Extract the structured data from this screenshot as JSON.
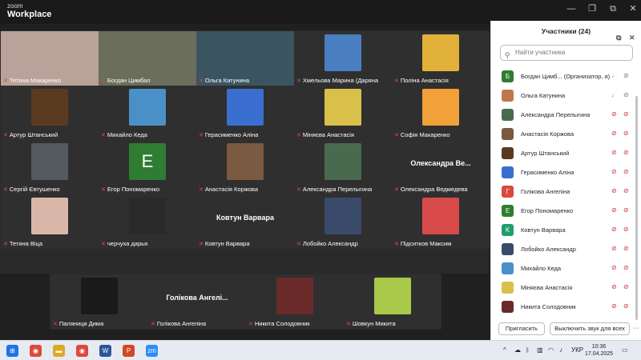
{
  "app": {
    "brand_small": "zoom",
    "brand": "Workplace"
  },
  "window_controls": {
    "minimize": "—",
    "maximize": "❐",
    "restore": "⧉",
    "close": "✕"
  },
  "grid_tiles": [
    {
      "name": "Тетяна Макаренко",
      "kind": "video",
      "color": "#b9a29a"
    },
    {
      "name": "Богдан Цимбал",
      "kind": "video",
      "color": "#6a6e5a",
      "active": true
    },
    {
      "name": "Ольга Катунина",
      "kind": "video",
      "color": "#3b5560"
    },
    {
      "name": "Хмельова Марина (Даряна",
      "kind": "image",
      "color": "#4a7fc1"
    },
    {
      "name": "Поліна Анастасія",
      "kind": "image",
      "color": "#e2b13a"
    },
    {
      "name": "Артур Штанський",
      "kind": "image",
      "color": "#5a3a1e"
    },
    {
      "name": "Михайло Кеда",
      "kind": "image",
      "color": "#4a90c8"
    },
    {
      "name": "Герасименко Аліна",
      "kind": "image",
      "color": "#3a6fd0"
    },
    {
      "name": "Міняєва Анастасія",
      "kind": "image",
      "color": "#d9c04a"
    },
    {
      "name": "Софія Макаренко",
      "kind": "image",
      "color": "#f1a03a"
    },
    {
      "name": "Сергій Євтушенко",
      "kind": "image",
      "color": "#555a60"
    },
    {
      "name": "Егор Пономаренко",
      "kind": "letter",
      "letter": "E",
      "color": "#2e7d32"
    },
    {
      "name": "Анастасія Коржова",
      "kind": "image",
      "color": "#7a5a40"
    },
    {
      "name": "Александра Перелыгина",
      "kind": "image",
      "color": "#4a6a50"
    },
    {
      "name": "Олександра Ведмедева",
      "kind": "name",
      "bigname": "Олександра Ве..."
    },
    {
      "name": "Тетяна Віца",
      "kind": "image",
      "color": "#d8b7a8"
    },
    {
      "name": "черчуха дарья",
      "kind": "image",
      "color": "#2a2a2a"
    },
    {
      "name": "Ковтун Варвара",
      "kind": "name",
      "bigname": "Ковтун Варвара"
    },
    {
      "name": "Лобойко Александр",
      "kind": "image",
      "color": "#3a4a6a"
    },
    {
      "name": "Підситков Максим",
      "kind": "image",
      "color": "#d84a4a"
    }
  ],
  "bottom_tiles": [
    {
      "name": "Паляниця Дима",
      "kind": "image",
      "color": "#1a1a1a"
    },
    {
      "name": "Голікова Ангеліна",
      "kind": "name",
      "bigname": "Голікова Ангелі..."
    },
    {
      "name": "Никита Солодовник",
      "kind": "image",
      "color": "#6a2a2a"
    },
    {
      "name": "Шовкун Микита",
      "kind": "image",
      "color": "#a8c94a"
    }
  ],
  "panel": {
    "title": "Участники (24)",
    "search_placeholder": "Найти участника",
    "participants": [
      {
        "name": "Богдан Цимб... (Организатор, я)",
        "avatar": "Б",
        "color": "#2e7d32",
        "muted": false
      },
      {
        "name": "Ольга Катунина",
        "avatar": "",
        "color": "#c0774a",
        "muted": false
      },
      {
        "name": "Александра Перелыгина",
        "avatar": "",
        "color": "#4a6a50",
        "muted": true
      },
      {
        "name": "Анастасія Коржова",
        "avatar": "",
        "color": "#7a5a40",
        "muted": true
      },
      {
        "name": "Артур Штанський",
        "avatar": "",
        "color": "#5a3a1e",
        "muted": true
      },
      {
        "name": "Герасименко Аліна",
        "avatar": "",
        "color": "#3a6fd0",
        "muted": true
      },
      {
        "name": "Голікова Ангеліна",
        "avatar": "Г",
        "color": "#d84a3a",
        "muted": true
      },
      {
        "name": "Егор Пономаренко",
        "avatar": "E",
        "color": "#2e7d32",
        "muted": true
      },
      {
        "name": "Ковтун Варвара",
        "avatar": "K",
        "color": "#1e9e6a",
        "muted": true
      },
      {
        "name": "Лобойко Александр",
        "avatar": "",
        "color": "#3a4a6a",
        "muted": true
      },
      {
        "name": "Михайло Кеда",
        "avatar": "",
        "color": "#4a90c8",
        "muted": true
      },
      {
        "name": "Міняєва Анастасія",
        "avatar": "",
        "color": "#d9c04a",
        "muted": true
      },
      {
        "name": "Никита Солодовник",
        "avatar": "",
        "color": "#6a2a2a",
        "muted": true
      }
    ],
    "invite": "Пригласить",
    "mute_all": "Выключить звук для всех",
    "more": "···"
  },
  "taskbar": {
    "apps": [
      {
        "name": "windows",
        "color": "#1a73e8",
        "glyph": "⊞"
      },
      {
        "name": "chrome",
        "color": "#dc4a3a",
        "glyph": "◉"
      },
      {
        "name": "explorer",
        "color": "#e0a820",
        "glyph": "▬"
      },
      {
        "name": "chrome2",
        "color": "#dc4a3a",
        "glyph": "◉"
      },
      {
        "name": "word",
        "color": "#2b579a",
        "glyph": "W"
      },
      {
        "name": "powerpoint",
        "color": "#d24726",
        "glyph": "P"
      },
      {
        "name": "zoom",
        "color": "#2d8cff",
        "glyph": "zm"
      }
    ],
    "lang": "УКР",
    "time": "10:36",
    "date": "17.04.2025"
  }
}
